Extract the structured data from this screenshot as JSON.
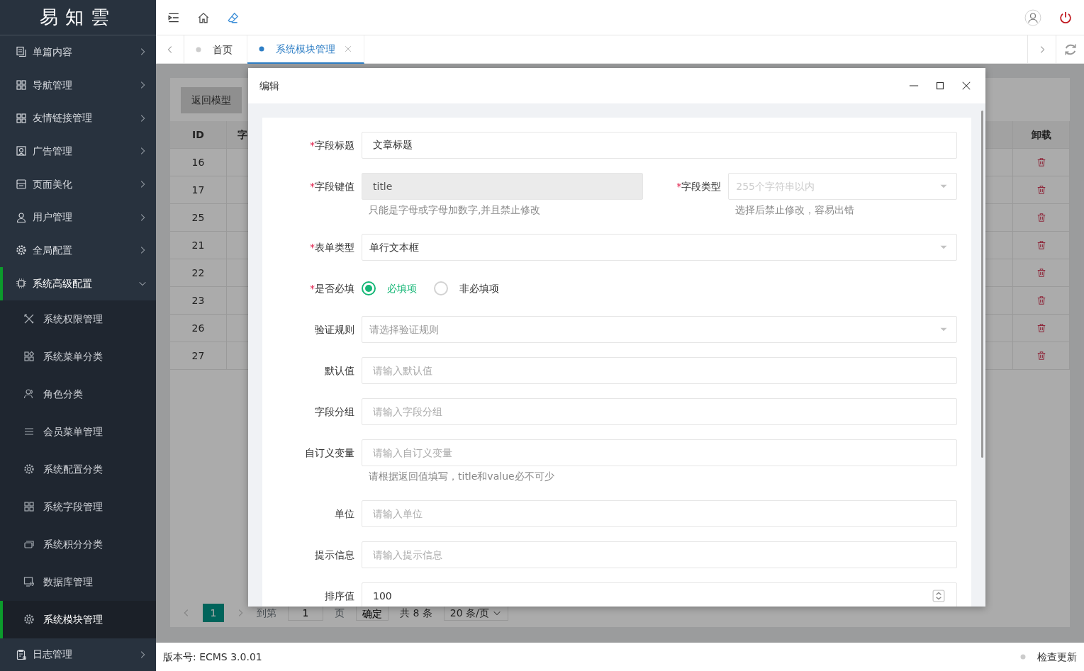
{
  "sidebar": {
    "logo": "易知雲",
    "items": [
      {
        "label": "单篇内容",
        "expanded": false,
        "selected": false
      },
      {
        "label": "导航管理",
        "expanded": false,
        "selected": false
      },
      {
        "label": "友情链接管理",
        "expanded": false,
        "selected": false
      },
      {
        "label": "广告管理",
        "expanded": false,
        "selected": false
      },
      {
        "label": "页面美化",
        "expanded": false,
        "selected": false
      },
      {
        "label": "用户管理",
        "expanded": false,
        "selected": false
      },
      {
        "label": "全局配置",
        "expanded": false,
        "selected": false
      },
      {
        "label": "系统高级配置",
        "expanded": true,
        "selected": false,
        "children": [
          {
            "label": "系统权限管理",
            "selected": false
          },
          {
            "label": "系统菜单分类",
            "selected": false
          },
          {
            "label": "角色分类",
            "selected": false
          },
          {
            "label": "会员菜单管理",
            "selected": false
          },
          {
            "label": "系统配置分类",
            "selected": false
          },
          {
            "label": "系统字段管理",
            "selected": false
          },
          {
            "label": "系统积分分类",
            "selected": false
          },
          {
            "label": "数据库管理",
            "selected": false
          },
          {
            "label": "系统模块管理",
            "selected": true
          }
        ]
      },
      {
        "label": "日志管理",
        "expanded": false,
        "selected": false
      }
    ]
  },
  "tabs": [
    {
      "label": "首页",
      "selected": false,
      "closable": false
    },
    {
      "label": "系统模块管理",
      "selected": true,
      "closable": true
    }
  ],
  "page": {
    "back_button": "返回模型",
    "table": {
      "columns": [
        "ID",
        "字",
        "卸载"
      ],
      "rows": [
        {
          "id": "16"
        },
        {
          "id": "17"
        },
        {
          "id": "25"
        },
        {
          "id": "21"
        },
        {
          "id": "22"
        },
        {
          "id": "23"
        },
        {
          "id": "26"
        },
        {
          "id": "27"
        }
      ]
    },
    "pagination": {
      "pages": [
        {
          "label": "1",
          "selected": true
        }
      ],
      "goto_label": "到第",
      "goto_value": "1",
      "page_unit": "页",
      "confirm": "确定",
      "total": "共 8 条",
      "page_size": "20 条/页"
    }
  },
  "dialog": {
    "title": "编辑",
    "rows": [
      {
        "fields": [
          {
            "label": "字段标题",
            "mark": "*",
            "kind": "text",
            "value": "文章标题",
            "disabled": false
          }
        ]
      },
      {
        "fields": [
          {
            "label": "字段键值",
            "mark": "*",
            "kind": "text",
            "value": "title",
            "disabled": true,
            "hint": "只能是字母或字母加数字,并且禁止修改"
          },
          {
            "label": "字段类型",
            "mark": "*",
            "kind": "select",
            "placeholder": "255个字符串以内",
            "disabled": true,
            "hint": "选择后禁止修改，容易出错"
          }
        ]
      },
      {
        "fields": [
          {
            "label": "表单类型",
            "mark": "*",
            "kind": "select",
            "value": "单行文本框",
            "disabled": false
          }
        ]
      },
      {
        "fields": [
          {
            "label": "是否必填",
            "mark": "*",
            "kind": "radio",
            "options": [
              {
                "label": "必填项",
                "selected": true
              },
              {
                "label": "非必填项",
                "selected": false
              }
            ]
          }
        ]
      },
      {
        "fields": [
          {
            "label": "验证规则",
            "kind": "select",
            "placeholder": "请选择验证规则",
            "disabled": false
          }
        ]
      },
      {
        "fields": [
          {
            "label": "默认值",
            "kind": "text",
            "placeholder": "请输入默认值",
            "disabled": false
          }
        ]
      },
      {
        "fields": [
          {
            "label": "字段分组",
            "kind": "text",
            "placeholder": "请输入字段分组",
            "disabled": false
          }
        ]
      },
      {
        "fields": [
          {
            "label": "自订义变量",
            "kind": "text",
            "placeholder": "请输入自订义变量",
            "disabled": false,
            "hint": "请根据返回值填写，title和value必不可少"
          }
        ]
      },
      {
        "fields": [
          {
            "label": "单位",
            "kind": "text",
            "placeholder": "请输入单位",
            "disabled": false
          }
        ]
      },
      {
        "fields": [
          {
            "label": "提示信息",
            "kind": "text",
            "placeholder": "请输入提示信息",
            "disabled": false
          }
        ]
      },
      {
        "fields": [
          {
            "label": "排序值",
            "kind": "number",
            "value": "100"
          }
        ]
      }
    ]
  },
  "footer": {
    "version": "版本号: ECMS 3.0.01",
    "update": "检查更新"
  }
}
